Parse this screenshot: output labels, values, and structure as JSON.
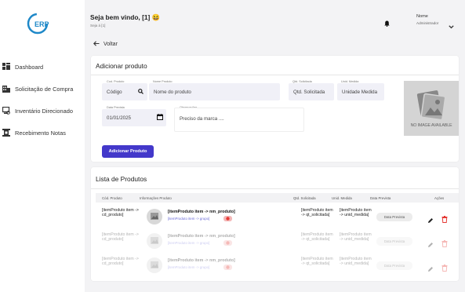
{
  "sidebar": {
    "logo_text": "ERP",
    "items": [
      {
        "label": "Dashboard",
        "icon": "dashboard-icon"
      },
      {
        "label": "Solicitação de Compra",
        "icon": "building-icon"
      },
      {
        "label": "Inventário Direcionado",
        "icon": "inventory-icon"
      },
      {
        "label": "Recebimento Notas",
        "icon": "receipt-icon"
      }
    ]
  },
  "header": {
    "welcome": "Seja bem vindo, [1] 😆",
    "welcome_sub": "Seja á [1]",
    "user_name": "Nome",
    "user_role": "Administrador"
  },
  "back_label": "Voltar",
  "form": {
    "title": "Adicionar produto",
    "cod_label": "Cod. Produto",
    "cod_value": "Código",
    "nome_label": "Nome Produto",
    "nome_placeholder": "Nome do produto",
    "qtd_label": "Qtd. Solicitada",
    "qtd_placeholder": "Qtd. Solicitada",
    "unid_label": "Unid. Medida",
    "unid_placeholder": "Unidade Medida",
    "data_label": "Data Prevista",
    "data_value": "01/01/2025",
    "obs_label": "Observações",
    "obs_placeholder": "Preciso da marca ....",
    "submit_label": "Adicionar Produto",
    "no_image_text": "NO IMAGE AVAILABLE"
  },
  "list": {
    "title": "Lista de Produtos",
    "columns": [
      "Cód. Produto",
      "Informações Produto",
      "Qtd. Solicitada",
      "Unid. Medida",
      "Data Prevista",
      "Ações"
    ],
    "rows": [
      {
        "cod": "[itemProduto item -> cd_produto]",
        "name": "[itemProduto item -> nm_produto]",
        "sub": "[itemProduto item -> grupo]",
        "qtd": "[itemProduto item -> qt_solicitada]",
        "unid": "[itemProduto item -> unid_medida]",
        "date": "Data Prevista",
        "dim": false
      },
      {
        "cod": "[itemProduto item -> cd_produto]",
        "name": "[itemProduto item -> nm_produto]",
        "sub": "[itemProduto item -> grupo]",
        "qtd": "[itemProduto item -> qt_solicitada]",
        "unid": "[itemProduto item -> unid_medida]",
        "date": "Data Prevista",
        "dim": true
      },
      {
        "cod": "[itemProduto item -> cd_produto]",
        "name": "[itemProduto item -> nm_produto]",
        "sub": "[itemProduto item -> grupo]",
        "qtd": "[itemProduto item -> qt_solicitada]",
        "unid": "[itemProduto item -> unid_medida]",
        "date": "Data Prevista",
        "dim": true
      }
    ]
  },
  "colors": {
    "accent": "#4338ca",
    "danger": "#e53935",
    "bg": "#f3f3f5"
  }
}
